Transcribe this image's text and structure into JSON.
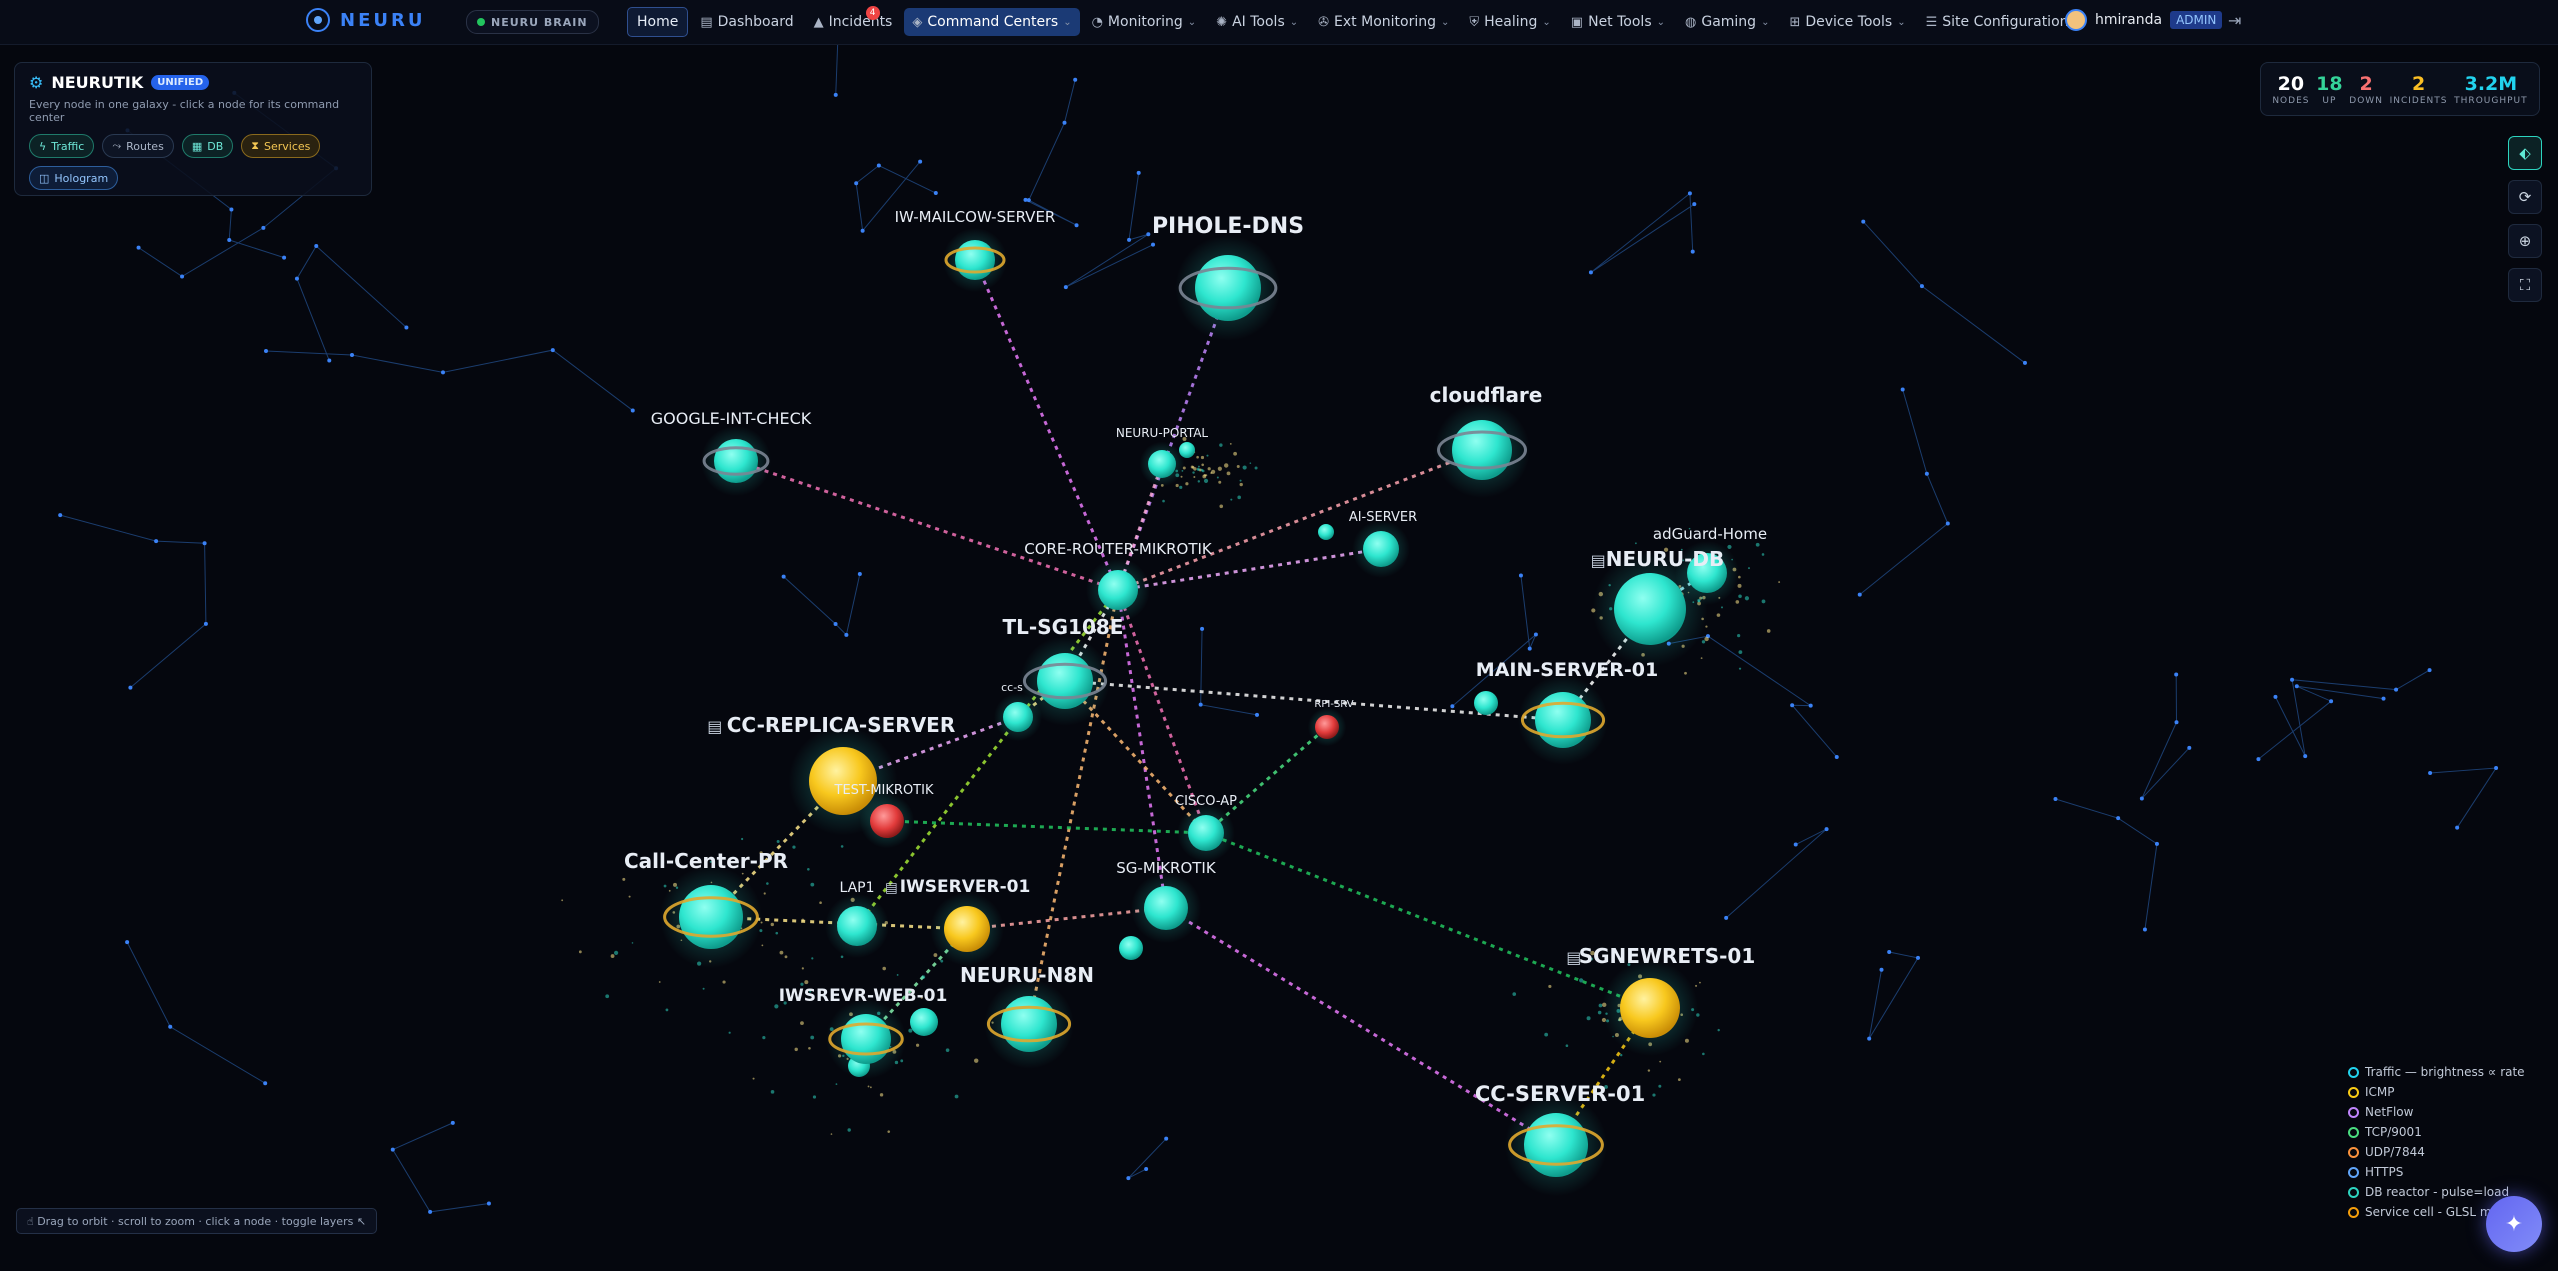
{
  "brand": {
    "name": "NEURU"
  },
  "brain": {
    "label": "NEURU BRAIN"
  },
  "nav": [
    {
      "id": "home",
      "label": "Home",
      "icon": "",
      "chevron": false
    },
    {
      "id": "dashboard",
      "label": "Dashboard",
      "icon": "chart-icon",
      "chevron": false
    },
    {
      "id": "incidents",
      "label": "Incidents",
      "icon": "warning-icon",
      "chevron": false,
      "badge": "4"
    },
    {
      "id": "command-centers",
      "label": "Command Centers",
      "icon": "command-icon",
      "chevron": true,
      "active": true
    },
    {
      "id": "monitoring",
      "label": "Monitoring",
      "icon": "gauge-icon",
      "chevron": true
    },
    {
      "id": "ai-tools",
      "label": "AI Tools",
      "icon": "brain-icon",
      "chevron": true
    },
    {
      "id": "ext-monitoring",
      "label": "Ext Monitoring",
      "icon": "satellite-icon",
      "chevron": true
    },
    {
      "id": "healing",
      "label": "Healing",
      "icon": "shield-icon",
      "chevron": true
    },
    {
      "id": "net-tools",
      "label": "Net Tools",
      "icon": "toolbox-icon",
      "chevron": true
    },
    {
      "id": "gaming",
      "label": "Gaming",
      "icon": "gamepad-icon",
      "chevron": true
    },
    {
      "id": "device-tools",
      "label": "Device Tools",
      "icon": "network-icon",
      "chevron": true
    },
    {
      "id": "site-configuration",
      "label": "Site Configuration",
      "icon": "sliders-icon",
      "chevron": true
    }
  ],
  "user": {
    "name": "hmiranda",
    "role": "ADMIN"
  },
  "panel": {
    "title": "NEURUTIK",
    "badge": "UNIFIED",
    "subtitle": "Every node in one galaxy - click a node for its command center",
    "chips": [
      {
        "id": "traffic",
        "label": "Traffic",
        "icon": "bolt-icon"
      },
      {
        "id": "routes",
        "label": "Routes",
        "icon": "route-icon"
      },
      {
        "id": "db",
        "label": "DB",
        "icon": "database-icon"
      },
      {
        "id": "services",
        "label": "Services",
        "icon": "hourglass-icon"
      },
      {
        "id": "hologram",
        "label": "Hologram",
        "icon": "cube-icon"
      }
    ]
  },
  "stats": [
    {
      "id": "nodes",
      "value": "20",
      "label": "NODES",
      "color": "#ffffff"
    },
    {
      "id": "up",
      "value": "18",
      "label": "UP",
      "color": "#34d399"
    },
    {
      "id": "down",
      "value": "2",
      "label": "DOWN",
      "color": "#f87171"
    },
    {
      "id": "incidents",
      "value": "2",
      "label": "INCIDENTS",
      "color": "#fbbf24"
    },
    {
      "id": "throughput",
      "value": "3.2M",
      "label": "THROUGHPUT",
      "color": "#22d3ee"
    }
  ],
  "tools": [
    {
      "id": "tag",
      "icon": "tag-icon"
    },
    {
      "id": "refresh",
      "icon": "refresh-icon"
    },
    {
      "id": "target",
      "icon": "crosshair-icon"
    },
    {
      "id": "fullscreen",
      "icon": "expand-icon"
    }
  ],
  "legend": [
    {
      "label": "Traffic — brightness ∝ rate",
      "color": "#22d3ee"
    },
    {
      "label": "ICMP",
      "color": "#facc15"
    },
    {
      "label": "NetFlow",
      "color": "#c084fc"
    },
    {
      "label": "TCP/9001",
      "color": "#4ade80"
    },
    {
      "label": "UDP/7844",
      "color": "#fb923c"
    },
    {
      "label": "HTTPS",
      "color": "#60a5fa"
    },
    {
      "label": "DB reactor - pulse=load",
      "color": "#2dd4bf"
    },
    {
      "label": "Service cell - GLSL m",
      "color": "#f59e0b"
    }
  ],
  "help": {
    "text": "☝ Drag to orbit · scroll to zoom · click a node · toggle layers ↖"
  },
  "nodes": [
    {
      "id": "iw-mailcow",
      "label": "IW-MAILCOW-SERVER",
      "status": "up",
      "ring": "gold"
    },
    {
      "id": "pihole",
      "label": "PIHOLE-DNS",
      "status": "up",
      "ring": "grey"
    },
    {
      "id": "google",
      "label": "GOOGLE-INT-CHECK",
      "status": "up",
      "ring": "grey"
    },
    {
      "id": "portal",
      "label": "NEURU-PORTAL",
      "status": "up",
      "ring": "none"
    },
    {
      "id": "cloudflare",
      "label": "cloudflare",
      "status": "up",
      "ring": "grey"
    },
    {
      "id": "ai-server",
      "label": "AI-SERVER",
      "status": "up",
      "ring": "none"
    },
    {
      "id": "core",
      "label": "CORE-ROUTER-MIKROTIK",
      "status": "up",
      "ring": "none"
    },
    {
      "id": "adguard",
      "label": "adGuard-Home",
      "status": "up",
      "ring": "none"
    },
    {
      "id": "neuru-db",
      "label": "NEURU-DB",
      "status": "up",
      "ring": "none",
      "db": true
    },
    {
      "id": "tl-sg108e",
      "label": "TL-SG108E",
      "status": "up",
      "ring": "grey"
    },
    {
      "id": "cc-small",
      "label": "cc-s",
      "status": "up",
      "ring": "none"
    },
    {
      "id": "main-server",
      "label": "MAIN-SERVER-01",
      "status": "up",
      "ring": "gold"
    },
    {
      "id": "rpi",
      "label": "RPI-SRV",
      "status": "down",
      "ring": "none"
    },
    {
      "id": "cc-replica",
      "label": "CC-REPLICA-SERVER",
      "status": "warn",
      "ring": "none",
      "db": true
    },
    {
      "id": "test-mikrotik",
      "label": "TEST-MIKROTIK",
      "status": "down",
      "ring": "none"
    },
    {
      "id": "cisco-ap",
      "label": "CISCO-AP",
      "status": "up",
      "ring": "none"
    },
    {
      "id": "call-center",
      "label": "Call-Center-PR",
      "status": "up",
      "ring": "gold"
    },
    {
      "id": "lap1",
      "label": "LAP1",
      "status": "up",
      "ring": "none"
    },
    {
      "id": "iwserver",
      "label": "IWSERVER-01",
      "status": "warn",
      "ring": "none",
      "db": true
    },
    {
      "id": "sg-mikrotik",
      "label": "SG-MIKROTIK",
      "status": "up",
      "ring": "none"
    },
    {
      "id": "sgnewrets",
      "label": "SGNEWRETS-01",
      "status": "warn",
      "ring": "none",
      "db": true
    },
    {
      "id": "iwsrevr-web",
      "label": "IWSREVR-WEB-01",
      "status": "up",
      "ring": "gold"
    },
    {
      "id": "neuru-n8n",
      "label": "NEURU-N8N",
      "status": "up",
      "ring": "gold"
    },
    {
      "id": "cc-server",
      "label": "CC-SERVER-01",
      "status": "up",
      "ring": "gold"
    }
  ]
}
